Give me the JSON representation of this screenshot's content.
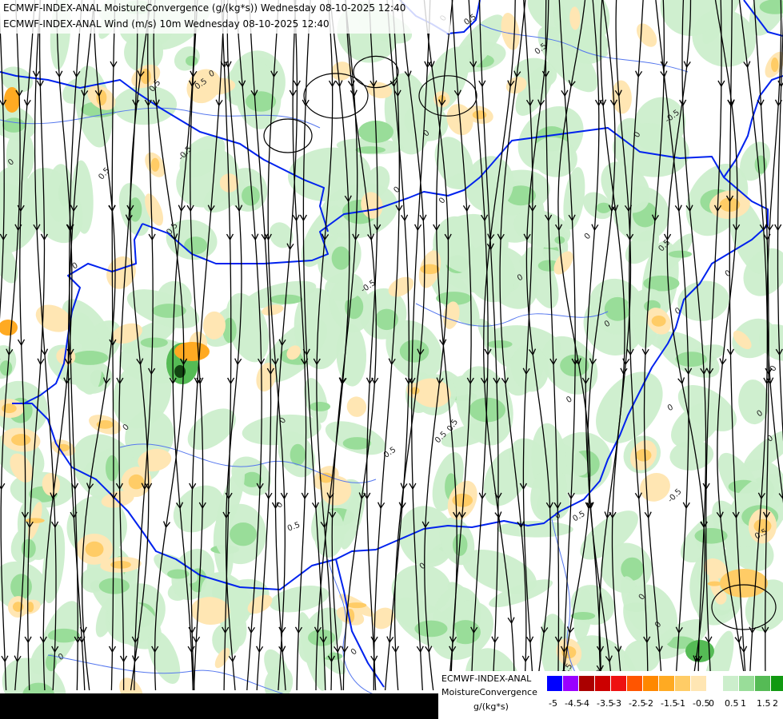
{
  "titles": {
    "line1": "ECMWF-INDEX-ANAL MoistureConvergence (g/(kg*s)) Wednesday 08-10-2025 12:40",
    "line2": "ECMWF-INDEX-ANAL Wind (m/s) 10m Wednesday 08-10-2025 12:40"
  },
  "legend": {
    "line1": "ECMWF-INDEX-ANAL",
    "line2": "MoistureConvergence",
    "unit": "g/(kg*s)",
    "ticks": [
      "-5",
      "-4.5",
      "-4",
      "-3.5",
      "-3",
      "-2.5",
      "-2",
      "-1.5",
      "-1",
      "-0.5",
      "0",
      "0.5",
      "1",
      "1.5",
      "2"
    ],
    "colors": [
      "#0000ff",
      "#9900ff",
      "#aa0000",
      "#cc0000",
      "#ee1111",
      "#ff5500",
      "#ff8800",
      "#ffaa22",
      "#ffcc66",
      "#ffe6b3",
      "#ffffff",
      "#cceecc",
      "#99dd99",
      "#55bb55",
      "#119911"
    ]
  },
  "contour_labels": [
    "0",
    "0.5",
    "-0.5"
  ],
  "colors": {
    "border": "#0022ee",
    "river": "#5577ee",
    "streamline": "#000000"
  }
}
